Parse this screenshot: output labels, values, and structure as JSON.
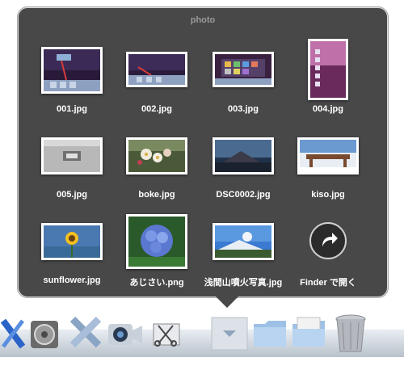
{
  "stack": {
    "title": "photo",
    "items": [
      {
        "label": "001.jpg"
      },
      {
        "label": "002.jpg"
      },
      {
        "label": "003.jpg"
      },
      {
        "label": "004.jpg"
      },
      {
        "label": "005.jpg"
      },
      {
        "label": "boke.jpg"
      },
      {
        "label": "DSC0002.jpg"
      },
      {
        "label": "kiso.jpg"
      },
      {
        "label": "sunflower.jpg"
      },
      {
        "label": "あじさい.png"
      },
      {
        "label": "浅間山噴火写真.jpg"
      }
    ],
    "open_in_finder": "Finder で開く"
  },
  "dock": {
    "items": [
      {
        "icon": "xcode-icon"
      },
      {
        "icon": "system-preferences-icon"
      },
      {
        "icon": "x11-icon"
      },
      {
        "icon": "facetime-icon"
      },
      {
        "icon": "scissors-grab-icon"
      },
      {
        "icon": "photo-stack-icon"
      },
      {
        "icon": "folder-icon"
      },
      {
        "icon": "downloads-folder-icon"
      },
      {
        "icon": "trash-icon"
      }
    ]
  }
}
